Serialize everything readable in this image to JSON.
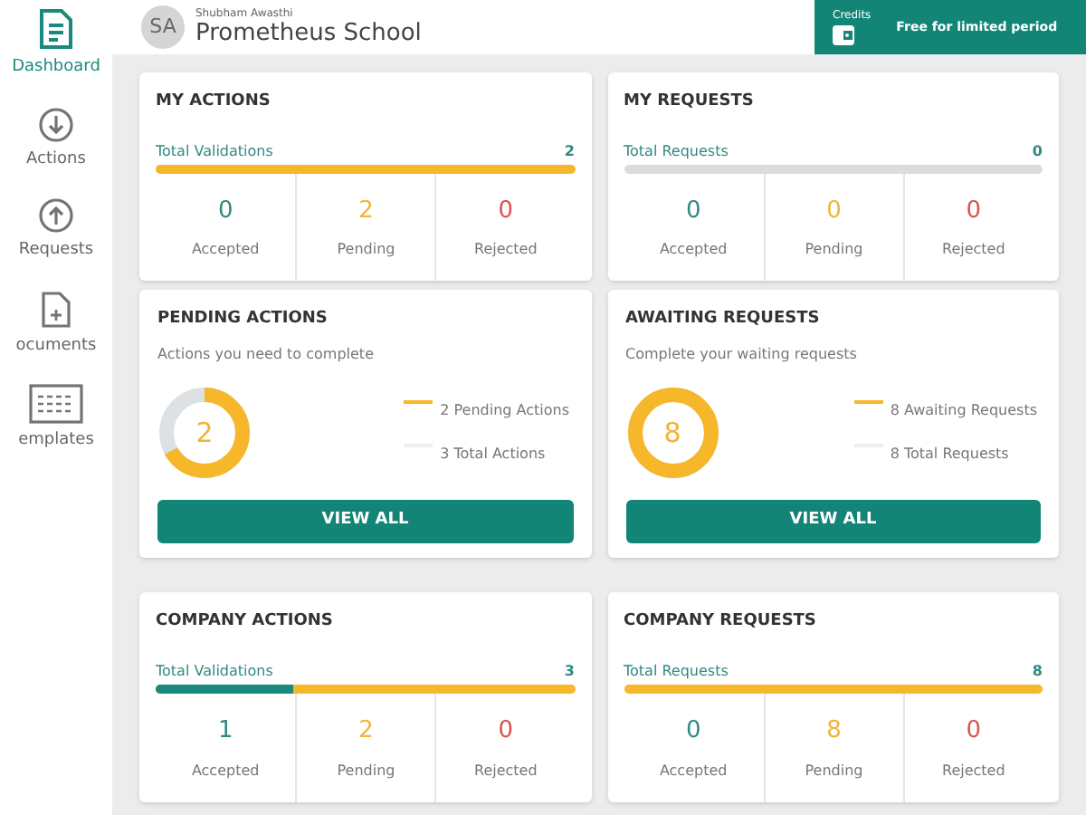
{
  "sidebar": {
    "items": [
      {
        "label": "Dashboard",
        "selected": true
      },
      {
        "label": "Actions",
        "selected": false
      },
      {
        "label": "Requests",
        "selected": false
      },
      {
        "label": "ocuments",
        "selected": false
      },
      {
        "label": "emplates",
        "selected": false
      }
    ]
  },
  "header": {
    "avatar": "SA",
    "user_name": "Shubham Awasthi",
    "organization": "Prometheus School",
    "credits": {
      "label": "Credits",
      "note": "Free for limited period"
    }
  },
  "stat_cards": [
    {
      "title": "MY ACTIONS",
      "total_label": "Total Validations",
      "total": "2",
      "bar": {
        "pending": true
      },
      "stats": [
        {
          "value": "0",
          "label": "Accepted"
        },
        {
          "value": "2",
          "label": "Pending"
        },
        {
          "value": "0",
          "label": "Rejected"
        }
      ]
    },
    {
      "title": "MY REQUESTS",
      "total_label": "Total Requests",
      "total": "0",
      "bar": {
        "pending": false
      },
      "stats": [
        {
          "value": "0",
          "label": "Accepted"
        },
        {
          "value": "0",
          "label": "Pending"
        },
        {
          "value": "0",
          "label": "Rejected"
        }
      ]
    }
  ],
  "summary_cards": [
    {
      "title": "PENDING ACTIONS",
      "subtitle": "Actions you need to complete",
      "count": "2",
      "level": 0.67,
      "legend": [
        "2 Pending Actions",
        "3 Total Actions"
      ],
      "button": "VIEW ALL"
    },
    {
      "title": "AWAITING REQUESTS",
      "subtitle": "Complete your waiting requests",
      "count": "8",
      "level": 1,
      "legend": [
        "8 Awaiting Requests",
        "8 Total Requests"
      ],
      "button": "VIEW ALL"
    }
  ],
  "company_cards": [
    {
      "title": "COMPANY ACTIONS",
      "total_label": "Total Validations",
      "total": "3",
      "bar": {
        "level": 0.33,
        "pending": true
      },
      "stats": [
        {
          "value": "1",
          "label": "Accepted"
        },
        {
          "value": "2",
          "label": "Pending"
        },
        {
          "value": "0",
          "label": "Rejected"
        }
      ]
    },
    {
      "title": "COMPANY REQUESTS",
      "total_label": "Total Requests",
      "total": "8",
      "bar": {
        "pending": true
      },
      "stats": [
        {
          "value": "0",
          "label": "Accepted"
        },
        {
          "value": "8",
          "label": "Pending"
        },
        {
          "value": "0",
          "label": "Rejected"
        }
      ]
    }
  ]
}
